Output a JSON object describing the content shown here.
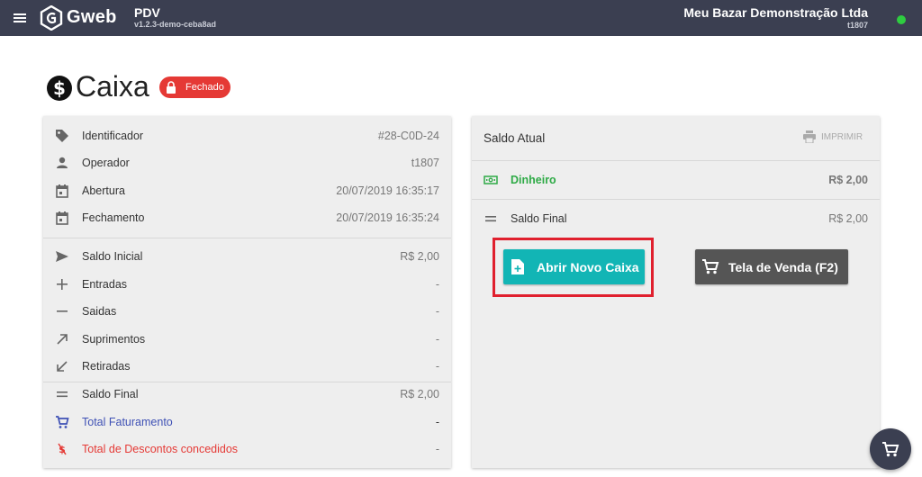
{
  "colors": {
    "topbar": "#3b3f51",
    "closed_badge": "#e53935",
    "primary_button": "#12b5b5",
    "secondary_button": "#555555",
    "accent_green": "#2eaa46",
    "highlight": "#e0202e"
  },
  "topbar": {
    "logo_text": "Gweb",
    "app_name": "PDV",
    "version": "v1.2.3-demo-ceba8ad",
    "company": "Meu Bazar Demonstração Ltda",
    "user": "t1807",
    "icons": [
      "menu-icon",
      "status-dot"
    ]
  },
  "page": {
    "title": "Caixa",
    "status_badge": "Fechado"
  },
  "info": {
    "rows": [
      {
        "icon": "tag-icon",
        "label": "Identificador",
        "value": "#28-C0D-24"
      },
      {
        "icon": "person-icon",
        "label": "Operador",
        "value": "t1807"
      },
      {
        "icon": "calendar-icon",
        "label": "Abertura",
        "value": "20/07/2019 16:35:17"
      },
      {
        "icon": "calendar-icon",
        "label": "Fechamento",
        "value": "20/07/2019 16:35:24"
      },
      {
        "icon": "send-icon",
        "label": "Saldo Inicial",
        "value": "R$ 2,00"
      },
      {
        "icon": "plus-icon",
        "label": "Entradas",
        "value": "-"
      },
      {
        "icon": "minus-icon",
        "label": "Saidas",
        "value": "-"
      },
      {
        "icon": "arrow-up-right-icon",
        "label": "Suprimentos",
        "value": "-"
      },
      {
        "icon": "arrow-down-left-icon",
        "label": "Retiradas",
        "value": "-"
      },
      {
        "icon": "equals-icon",
        "label": "Saldo Final",
        "value": "R$ 2,00"
      },
      {
        "icon": "cart-icon",
        "label": "Total Faturamento",
        "value": "-"
      },
      {
        "icon": "discount-icon",
        "label": "Total de Descontos concedidos",
        "value": "-"
      }
    ]
  },
  "saldo": {
    "title": "Saldo Atual",
    "print_label": "IMPRIMIR",
    "rows": [
      {
        "icon": "cash-icon",
        "label": "Dinheiro",
        "value": "R$ 2,00"
      },
      {
        "icon": "equals-icon",
        "label": "Saldo Final",
        "value": "R$ 2,00"
      }
    ]
  },
  "actions": {
    "open_label": "Abrir Novo Caixa",
    "sale_label": "Tela de Venda (F2)"
  }
}
